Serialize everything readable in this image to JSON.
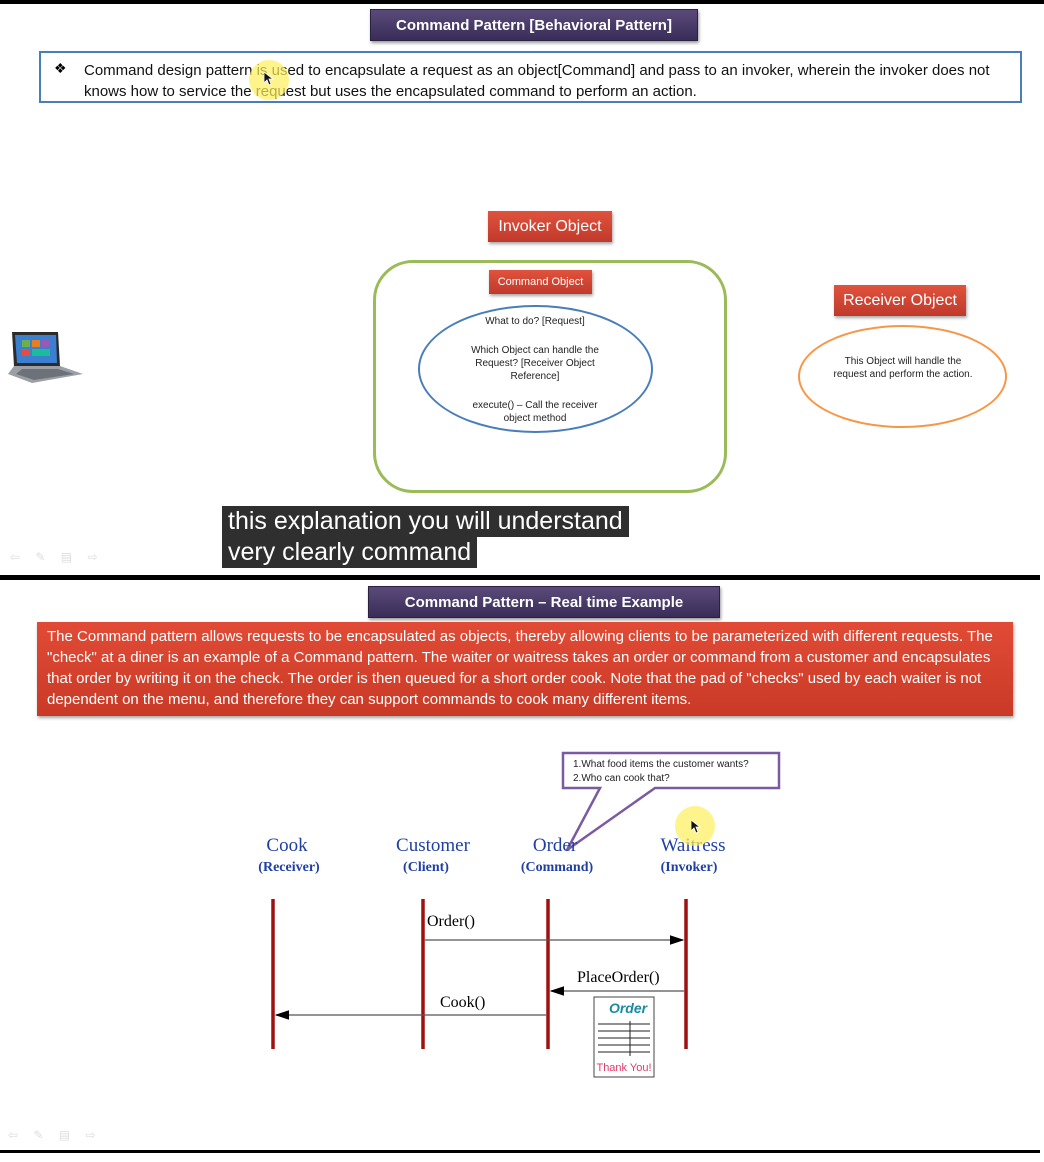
{
  "slide1": {
    "title": "Command Pattern [Behavioral Pattern]",
    "definition": "Command design pattern is used to encapsulate a request as an object[Command] and pass to an invoker, wherein the invoker does not knows how to service the request but uses the encapsulated command to perform an action.",
    "bullet": "❖",
    "invoker_label": "Invoker Object",
    "command_label": "Command Object",
    "command_oval": {
      "line1": "What to do? [Request]",
      "line2": "Which Object can handle the Request? [Receiver Object Reference]",
      "line3": "execute() – Call the receiver object method"
    },
    "receiver_label": "Receiver Object",
    "receiver_oval": "This Object will handle the request and perform the action.",
    "caption_line1": "this explanation you will understand",
    "caption_line2": "very clearly command",
    "nav_icons": "⇦ ✎ ▤ ⇨"
  },
  "slide2": {
    "title": "Command Pattern – Real time Example",
    "example_text": "The Command pattern allows requests to be encapsulated as objects, thereby allowing clients to be parameterized with different requests. The \"check\" at a diner is an example of a Command pattern. The waiter or waitress takes an order or command from a customer and encapsulates that order by writing it on the check. The order is then queued for a short order cook. Note that the pad of \"checks\" used by each waiter is not dependent on the menu, and therefore they can support commands to cook many different items.",
    "callout_line1": "1.What food items the customer wants?",
    "callout_line2": "2.Who can cook that?",
    "participants": [
      {
        "name": "Cook",
        "role": "(Receiver)"
      },
      {
        "name": "Customer",
        "role": "(Client)"
      },
      {
        "name": "Order",
        "role": "(Command)"
      },
      {
        "name": "Waitress",
        "role": "(Invoker)"
      }
    ],
    "messages": {
      "order": "Order()",
      "place_order": "PlaceOrder()",
      "cook": "Cook()"
    },
    "check_title": "Order",
    "check_footer": "Thank You!",
    "nav_icons": "⇦ ✎ ▤ ⇨"
  }
}
